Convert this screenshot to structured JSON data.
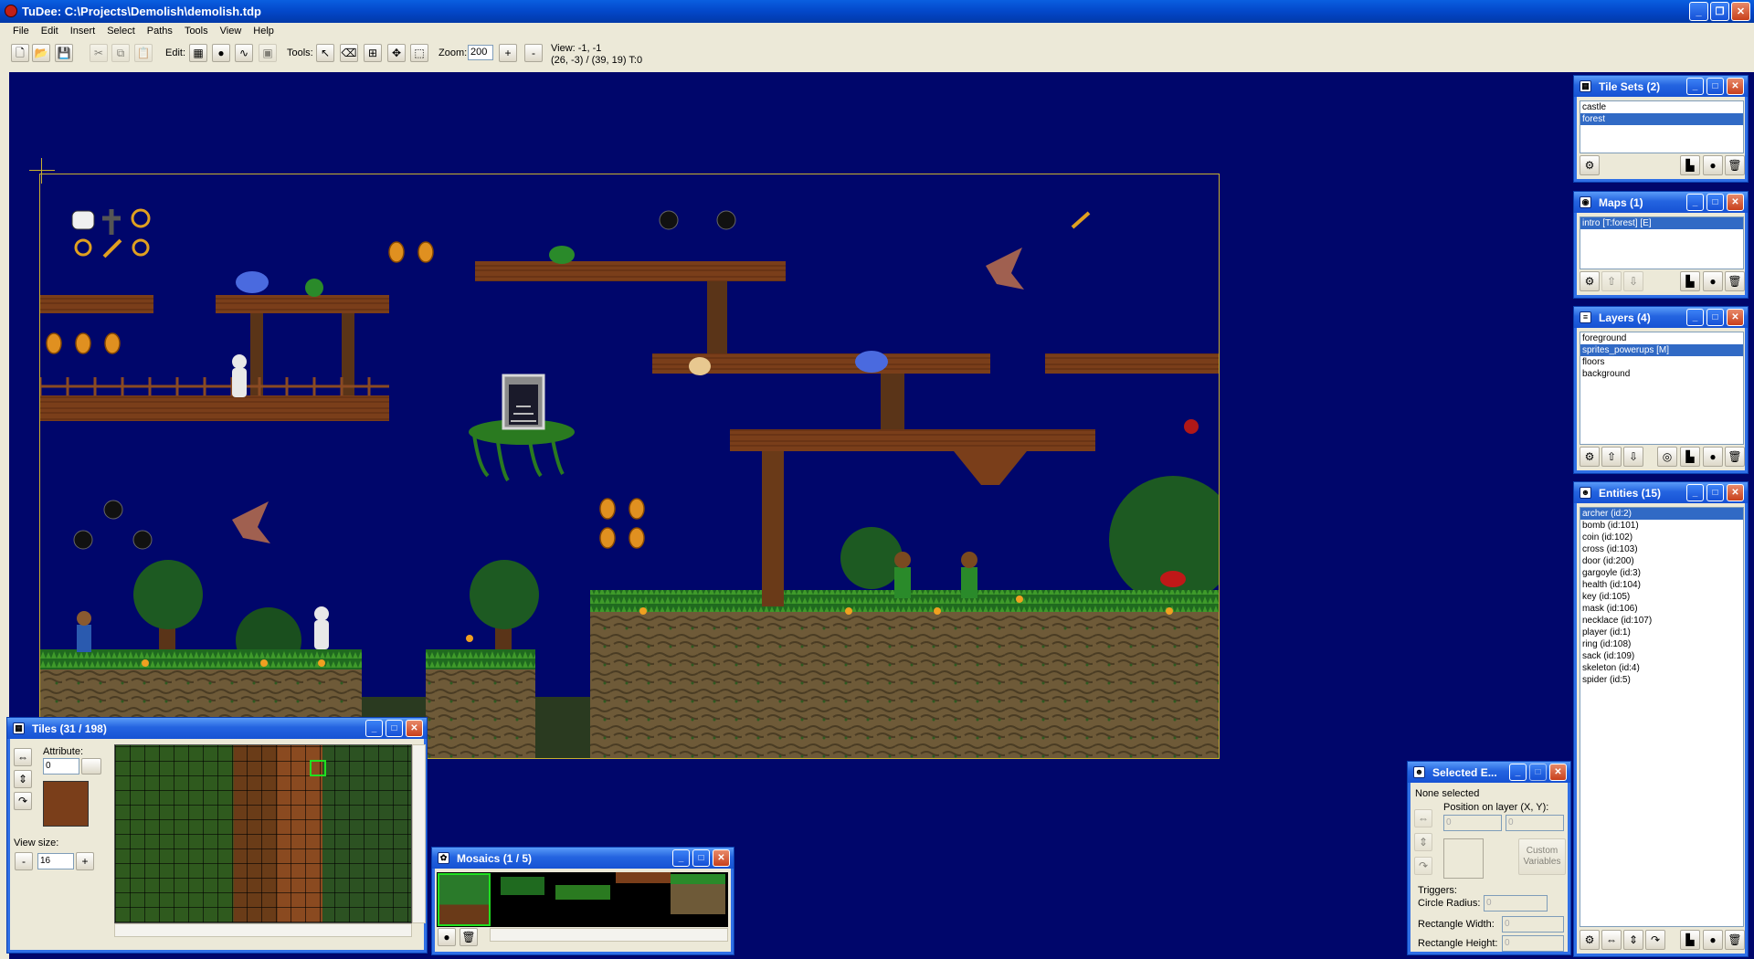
{
  "window": {
    "title": "TuDee: C:\\Projects\\Demolish\\demolish.tdp"
  },
  "menu": [
    "File",
    "Edit",
    "Insert",
    "Select",
    "Paths",
    "Tools",
    "View",
    "Help"
  ],
  "toolbar": {
    "edit_label": "Edit:",
    "tools_label": "Tools:",
    "zoom_label": "Zoom:",
    "zoom_value": "200",
    "zoom_in": "+",
    "zoom_out": "-",
    "view_line1": "View: -1, -1",
    "view_line2": "(26, -3) / (39, 19)  T:0"
  },
  "tilesets": {
    "title": "Tile Sets (2)",
    "items": [
      {
        "label": "castle",
        "selected": false
      },
      {
        "label": "forest",
        "selected": true
      }
    ]
  },
  "maps": {
    "title": "Maps (1)",
    "items": [
      {
        "label": "intro     [T:forest] [E]",
        "selected": true
      }
    ]
  },
  "layers": {
    "title": "Layers (4)",
    "items": [
      {
        "label": "foreground",
        "selected": false
      },
      {
        "label": "sprites_powerups     [M]",
        "selected": true
      },
      {
        "label": "floors",
        "selected": false
      },
      {
        "label": "background",
        "selected": false
      }
    ]
  },
  "entities": {
    "title": "Entities (15)",
    "items": [
      {
        "label": "archer    (id:2)",
        "selected": true
      },
      {
        "label": "bomb    (id:101)",
        "selected": false
      },
      {
        "label": "coin    (id:102)",
        "selected": false
      },
      {
        "label": "cross    (id:103)",
        "selected": false
      },
      {
        "label": "door    (id:200)",
        "selected": false
      },
      {
        "label": "gargoyle    (id:3)",
        "selected": false
      },
      {
        "label": "health    (id:104)",
        "selected": false
      },
      {
        "label": "key    (id:105)",
        "selected": false
      },
      {
        "label": "mask    (id:106)",
        "selected": false
      },
      {
        "label": "necklace    (id:107)",
        "selected": false
      },
      {
        "label": "player    (id:1)",
        "selected": false
      },
      {
        "label": "ring    (id:108)",
        "selected": false
      },
      {
        "label": "sack    (id:109)",
        "selected": false
      },
      {
        "label": "skeleton    (id:4)",
        "selected": false
      },
      {
        "label": "spider    (id:5)",
        "selected": false
      }
    ]
  },
  "tiles": {
    "title": "Tiles   (31 / 198)",
    "attribute_label": "Attribute:",
    "attribute_value": "0",
    "view_size_label": "View size:",
    "view_size_value": "16",
    "minus": "-",
    "plus": "+"
  },
  "mosaics": {
    "title": "Mosaics   (1 / 5)"
  },
  "selected_entity": {
    "title": "Selected E...",
    "none_selected": "None selected",
    "position_label": "Position on layer (X, Y):",
    "pos_x": "0",
    "pos_y": "0",
    "custom_variables": "Custom Variables",
    "triggers_label": "Triggers:",
    "circle_radius_label": "Circle Radius:",
    "circle_radius_value": "0",
    "rect_width_label": "Rectangle Width:",
    "rect_width_value": "0",
    "rect_height_label": "Rectangle Height:",
    "rect_height_value": "0"
  },
  "colors": {
    "workspace": "#00066b",
    "selection": "#316ac5",
    "caption": "#2464e0"
  }
}
